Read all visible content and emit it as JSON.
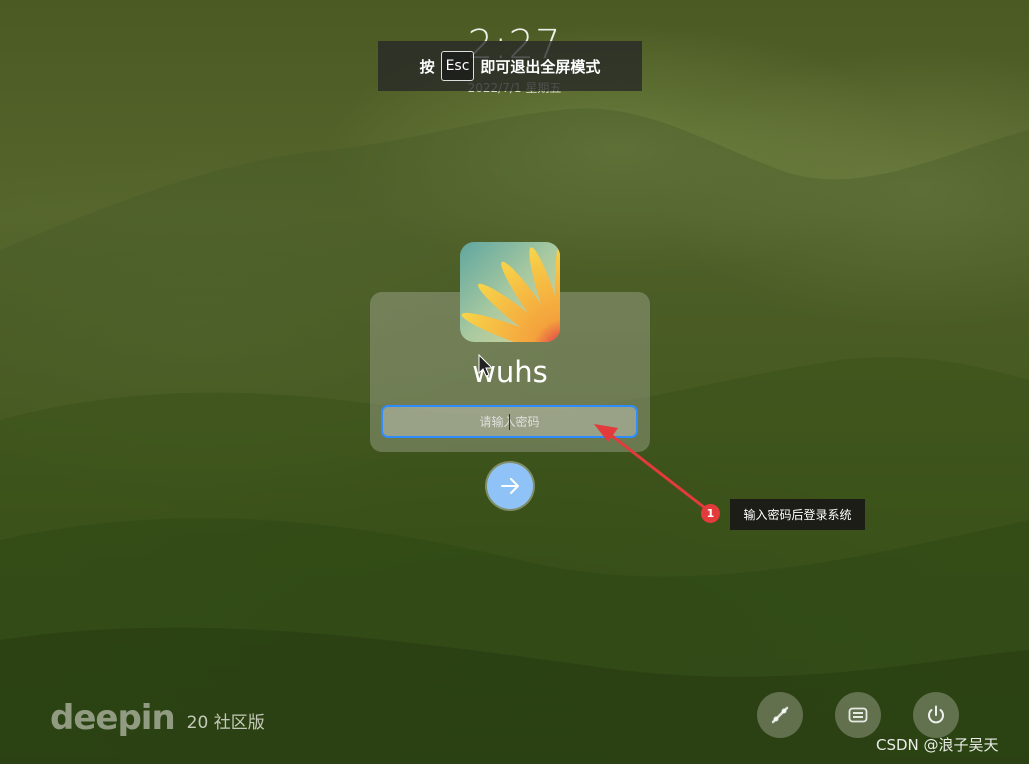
{
  "clock": {
    "time": "2:27",
    "date": "2022/7/1 星期五"
  },
  "esc_banner": {
    "prefix": "按",
    "key": "Esc",
    "suffix": "即可退出全屏模式"
  },
  "login": {
    "username": "wuhs",
    "password_placeholder": "请输入密码"
  },
  "annotation": {
    "badge": "1",
    "text": "输入密码后登录系统"
  },
  "brand": {
    "logo": "deepin",
    "edition": "20 社区版"
  },
  "tray": {
    "items": [
      {
        "icon": "user-switch-icon"
      },
      {
        "icon": "keyboard-icon"
      },
      {
        "icon": "power-icon"
      }
    ]
  },
  "watermark": "CSDN @浪子吴天",
  "colors": {
    "accent": "#2f8cff",
    "submit": "#8fc3f7",
    "annotation_red": "#e33b3b"
  }
}
